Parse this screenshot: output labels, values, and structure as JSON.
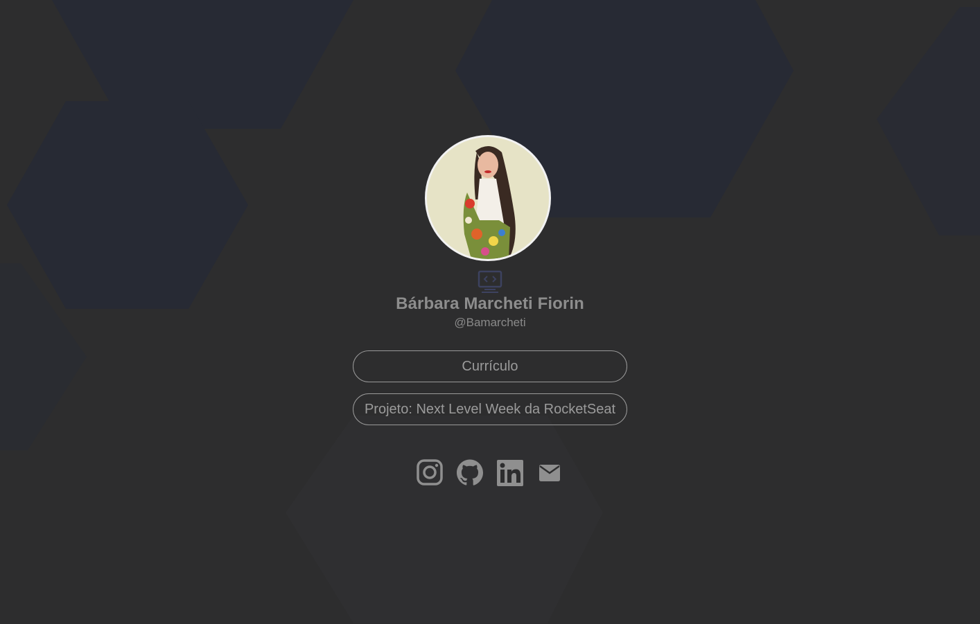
{
  "profile": {
    "name": "Bárbara Marcheti Fiorin",
    "handle": "@Bamarcheti"
  },
  "links": [
    {
      "label": "Currículo"
    },
    {
      "label": "Projeto: Next Level Week da RocketSeat"
    }
  ],
  "social": [
    {
      "icon": "instagram-icon"
    },
    {
      "icon": "github-icon"
    },
    {
      "icon": "linkedin-icon"
    },
    {
      "icon": "mail-icon"
    }
  ],
  "colors": {
    "background": "#2d2d2e",
    "hexagon": "#272a34",
    "text": "#8d8d8d",
    "border": "#9a9a9a",
    "icon": "#8f8f8f"
  }
}
